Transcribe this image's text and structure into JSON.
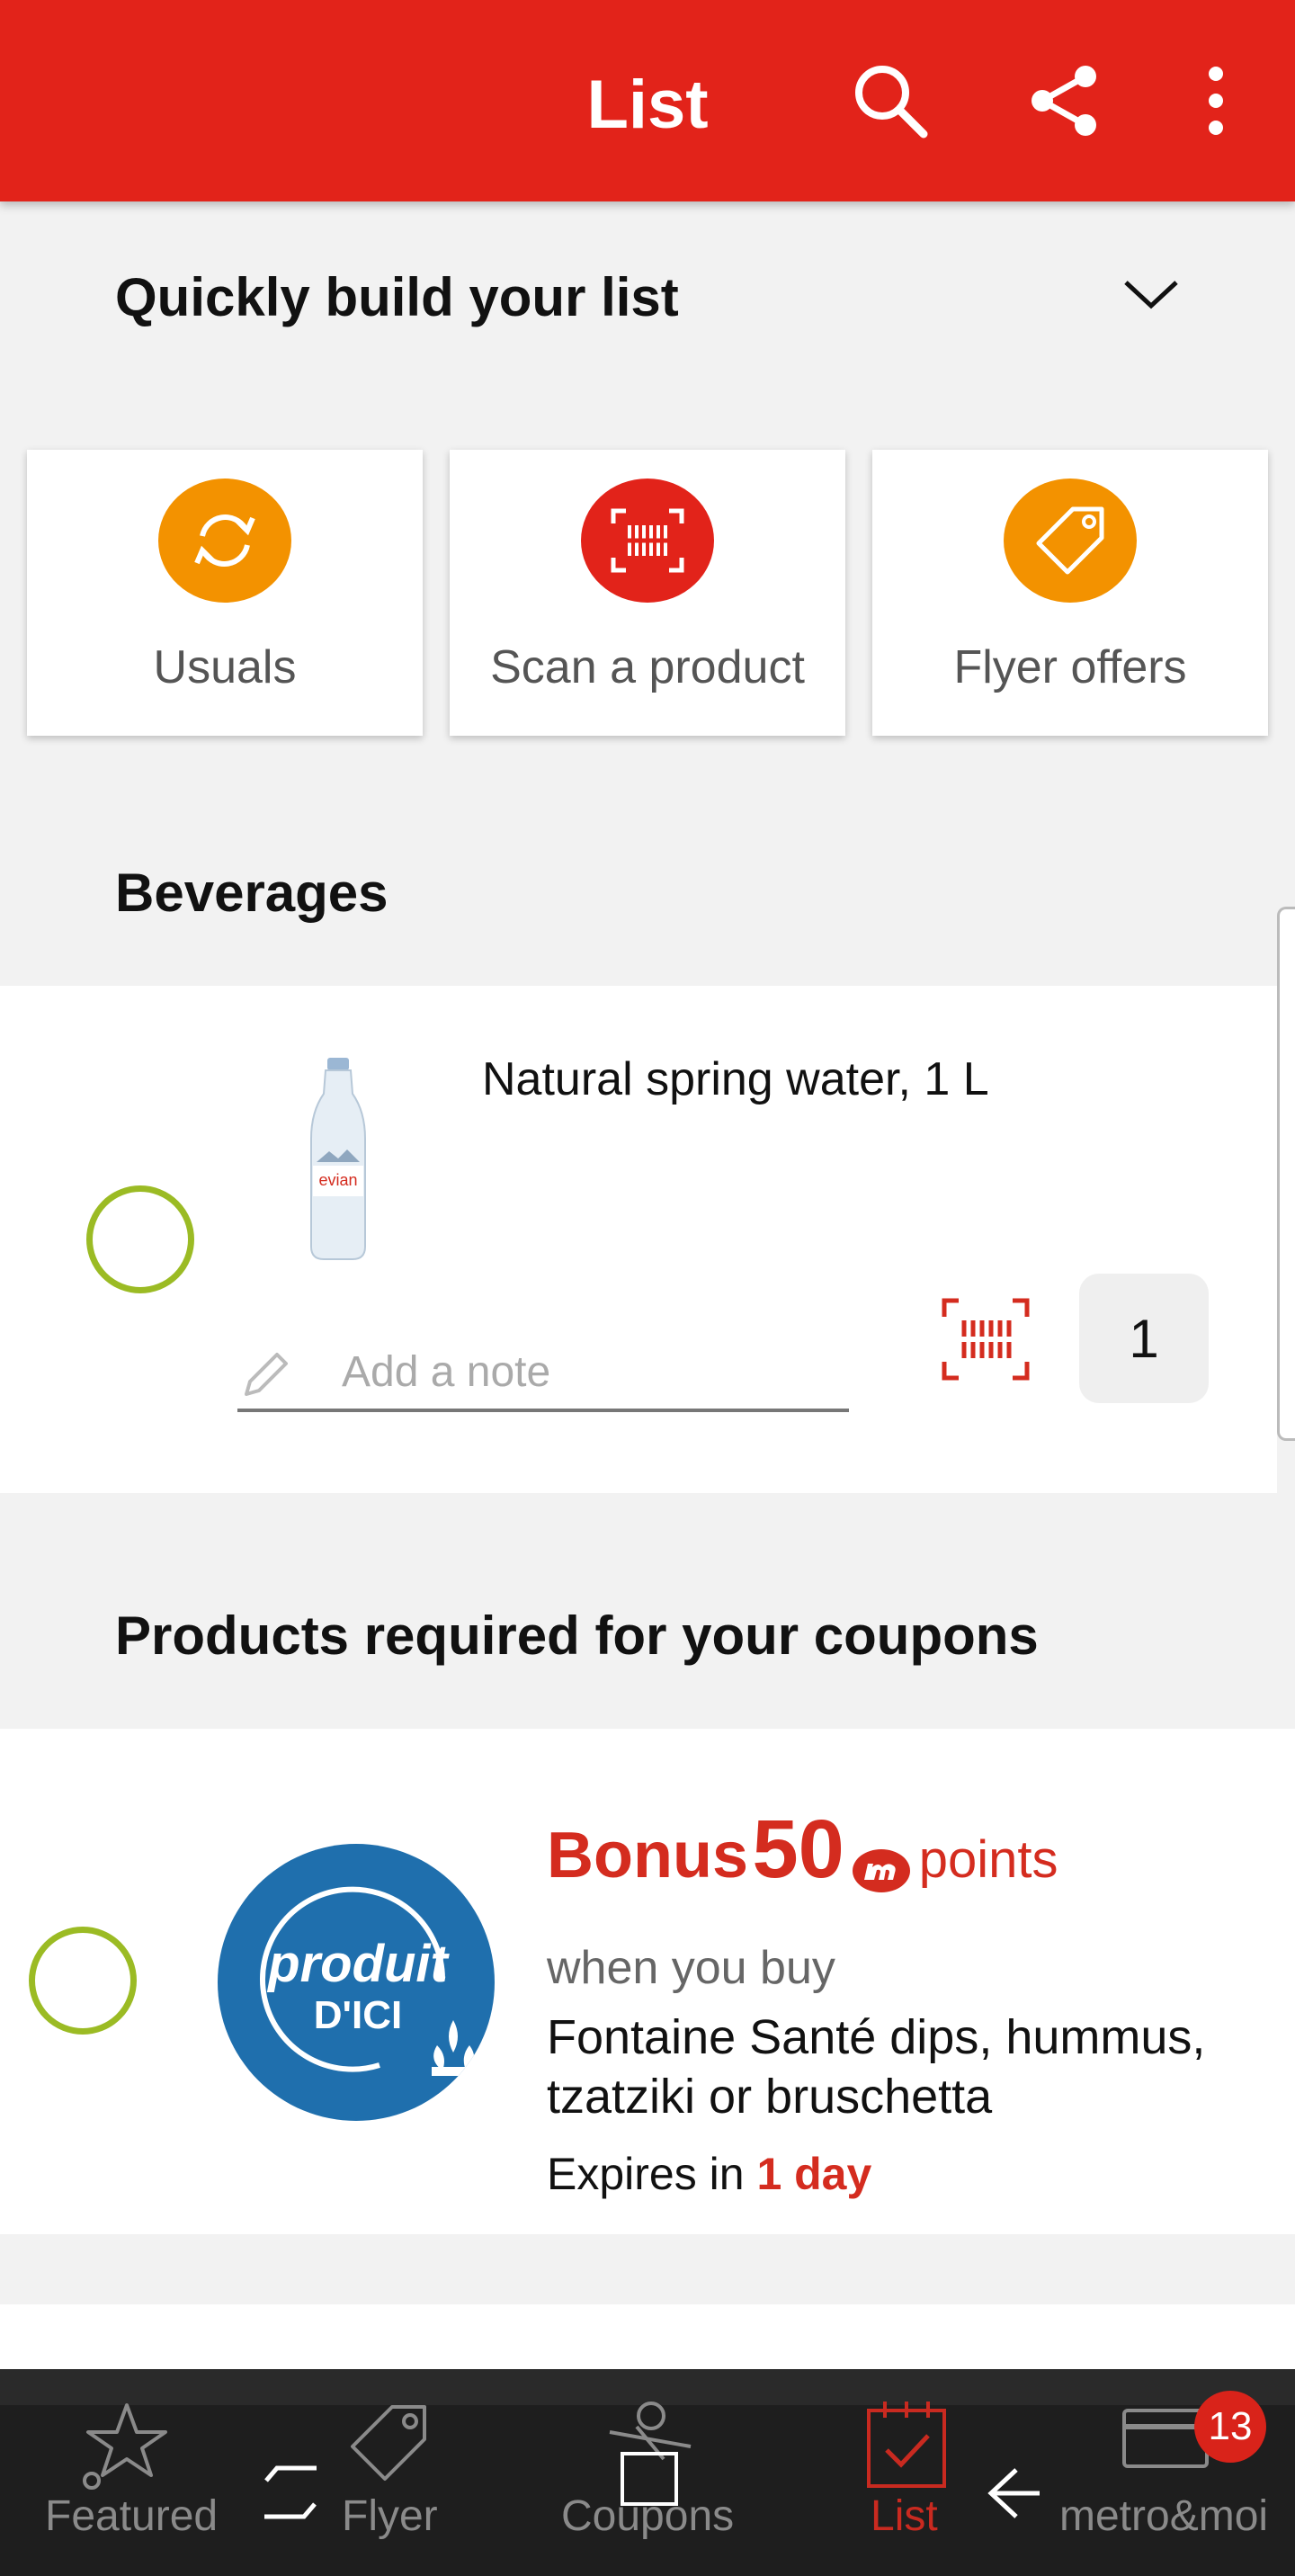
{
  "header": {
    "title": "List",
    "icons": [
      "search-icon",
      "share-icon",
      "more-vertical-icon"
    ],
    "background": "#e2231a"
  },
  "quick_build": {
    "title": "Quickly build your list",
    "cards": [
      {
        "label": "Usuals",
        "icon": "refresh-icon",
        "color": "#f39200"
      },
      {
        "label": "Scan a product",
        "icon": "barcode-icon",
        "color": "#e2231a"
      },
      {
        "label": "Flyer offers",
        "icon": "tag-icon",
        "color": "#f39200"
      }
    ]
  },
  "beverages": {
    "title": "Beverages",
    "item": {
      "name": "Natural spring water, 1 L",
      "note_placeholder": "Add a note",
      "quantity": "1",
      "image_brand": "evian"
    }
  },
  "coupons": {
    "title": "Products required for your coupons",
    "card": {
      "logo_line1": "produit",
      "logo_line2": "D'ICI",
      "bonus_word": "Bonus",
      "bonus_points": "50",
      "points_word": "points",
      "when": "when you buy",
      "description": "Fontaine Santé dips, hummus, tzatziki or bruschetta",
      "expires_prefix": "Expires in",
      "expires_value": "1 day"
    }
  },
  "bottom_nav": {
    "items": [
      {
        "label": "Featured",
        "icon": "star-icon",
        "active": false
      },
      {
        "label": "Flyer",
        "icon": "tag-icon",
        "active": false
      },
      {
        "label": "Coupons",
        "icon": "scissors-icon",
        "active": false
      },
      {
        "label": "List",
        "icon": "checklist-icon",
        "active": true
      },
      {
        "label": "metro&moi",
        "icon": "card-icon",
        "active": false
      }
    ],
    "badge_count": "13",
    "accent": "#c92a20"
  }
}
